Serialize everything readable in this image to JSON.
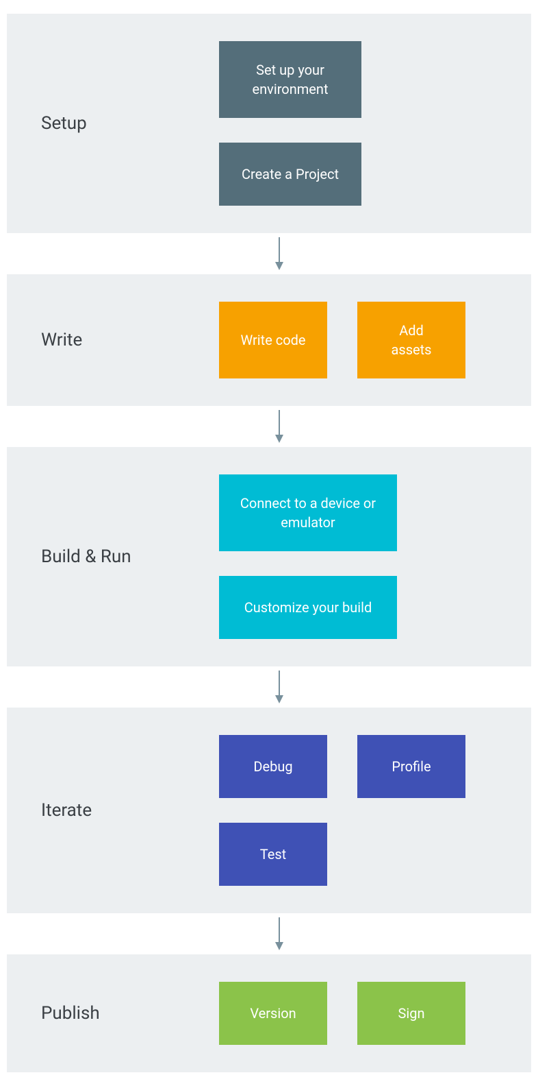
{
  "stages": [
    {
      "label": "Setup",
      "color": "setup",
      "layout": "column",
      "cards": [
        {
          "text": "Set up your environment"
        },
        {
          "text": "Create a Project"
        }
      ]
    },
    {
      "label": "Write",
      "color": "write",
      "layout": "row",
      "cards": [
        {
          "text": "Write code"
        },
        {
          "text": "Add assets"
        }
      ]
    },
    {
      "label": "Build & Run",
      "color": "build",
      "layout": "column",
      "cards": [
        {
          "text": "Connect to a device or emulator"
        },
        {
          "text": "Customize your build"
        }
      ]
    },
    {
      "label": "Iterate",
      "color": "iterate",
      "layout": "rows",
      "cards": [
        {
          "text": "Debug"
        },
        {
          "text": "Profile"
        },
        {
          "text": "Test"
        }
      ]
    },
    {
      "label": "Publish",
      "color": "publish",
      "layout": "row",
      "cards": [
        {
          "text": "Version"
        },
        {
          "text": "Sign"
        }
      ]
    }
  ]
}
